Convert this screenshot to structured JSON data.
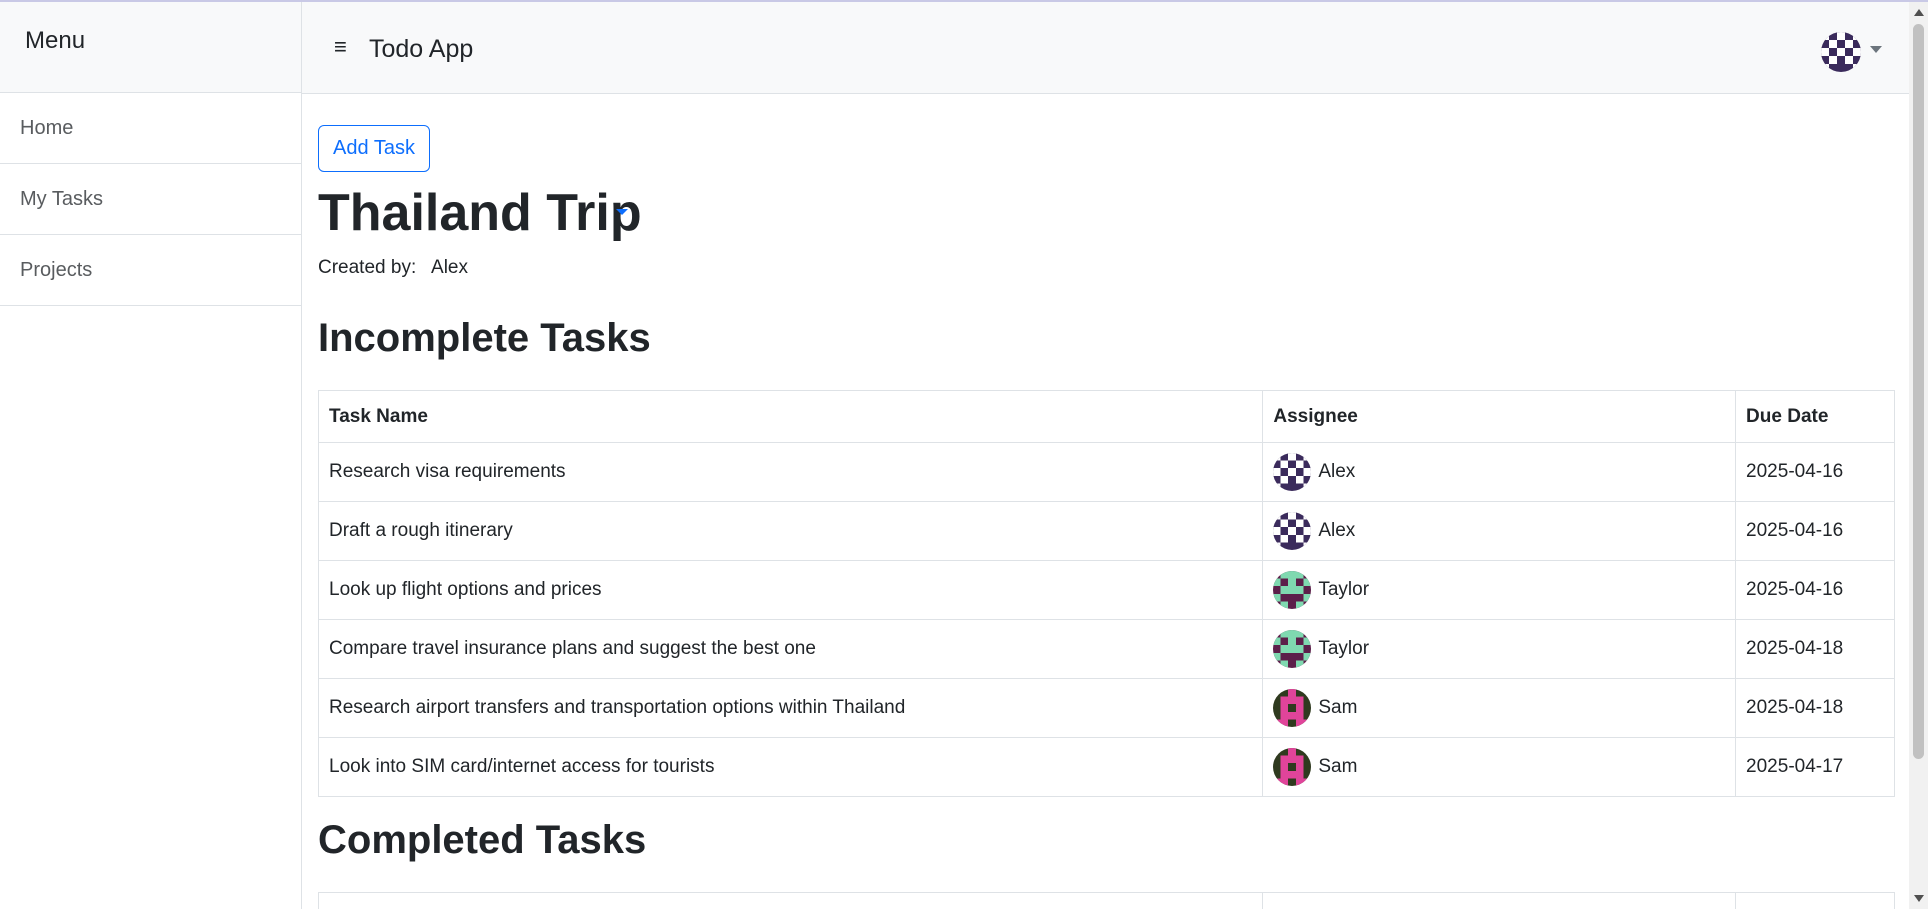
{
  "sidebar": {
    "title": "Menu",
    "items": [
      {
        "label": "Home"
      },
      {
        "label": "My Tasks"
      },
      {
        "label": "Projects"
      }
    ]
  },
  "navbar": {
    "menu_icon": "hamburger-icon",
    "app_title": "Todo App",
    "user_avatar_icon": "avatar-identicon",
    "dropdown_icon": "caret-down-icon"
  },
  "main": {
    "add_task_label": "Add Task",
    "project_title": "Thailand Trip",
    "created_by_label": "Created by:",
    "created_by_name": "Alex",
    "incomplete_heading": "Incomplete Tasks",
    "completed_heading": "Completed Tasks",
    "columns": [
      "Task Name",
      "Assignee",
      "Due Date"
    ],
    "incomplete_tasks": [
      {
        "name": "Research visa requirements",
        "assignee": "Alex",
        "due": "2025-04-16"
      },
      {
        "name": "Draft a rough itinerary",
        "assignee": "Alex",
        "due": "2025-04-16"
      },
      {
        "name": "Look up flight options and prices",
        "assignee": "Taylor",
        "due": "2025-04-16"
      },
      {
        "name": "Compare travel insurance plans and suggest the best one",
        "assignee": "Taylor",
        "due": "2025-04-18"
      },
      {
        "name": "Research airport transfers and transportation options within Thailand",
        "assignee": "Sam",
        "due": "2025-04-18"
      },
      {
        "name": "Look into SIM card/internet access for tourists",
        "assignee": "Sam",
        "due": "2025-04-17"
      }
    ]
  },
  "colors": {
    "primary": "#0d6efd",
    "border": "#dee2e6",
    "navbar_bg": "#f8f9fa",
    "avatar_alex": "#3b2b5c",
    "avatar_taylor": "#5c1f4a",
    "avatar_sam": "#2f3a1f"
  }
}
